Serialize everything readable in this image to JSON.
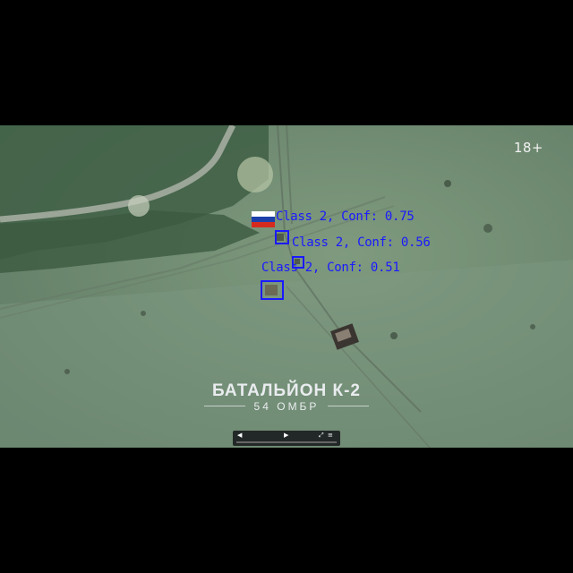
{
  "video": {
    "age_rating": "18+",
    "watermark_title": "БАТАЛЬЙОН К-2",
    "watermark_subtitle": "54 ОМБР",
    "flag_colors": [
      "#ffffff",
      "#1c3faa",
      "#d52b1e"
    ]
  },
  "detections": [
    {
      "label": "Class 2, Conf: 0.75",
      "color": "#1a1aff"
    },
    {
      "label": "Class 2, Conf: 0.56",
      "color": "#1a1aff"
    },
    {
      "label": "Class 2, Conf: 0.51",
      "color": "#1a1aff"
    }
  ],
  "player_controls": {
    "rewind_icon": "rewind-icon",
    "play_icon": "play-icon",
    "fullscreen_icon": "fullscreen-icon",
    "progress": 0.0
  }
}
